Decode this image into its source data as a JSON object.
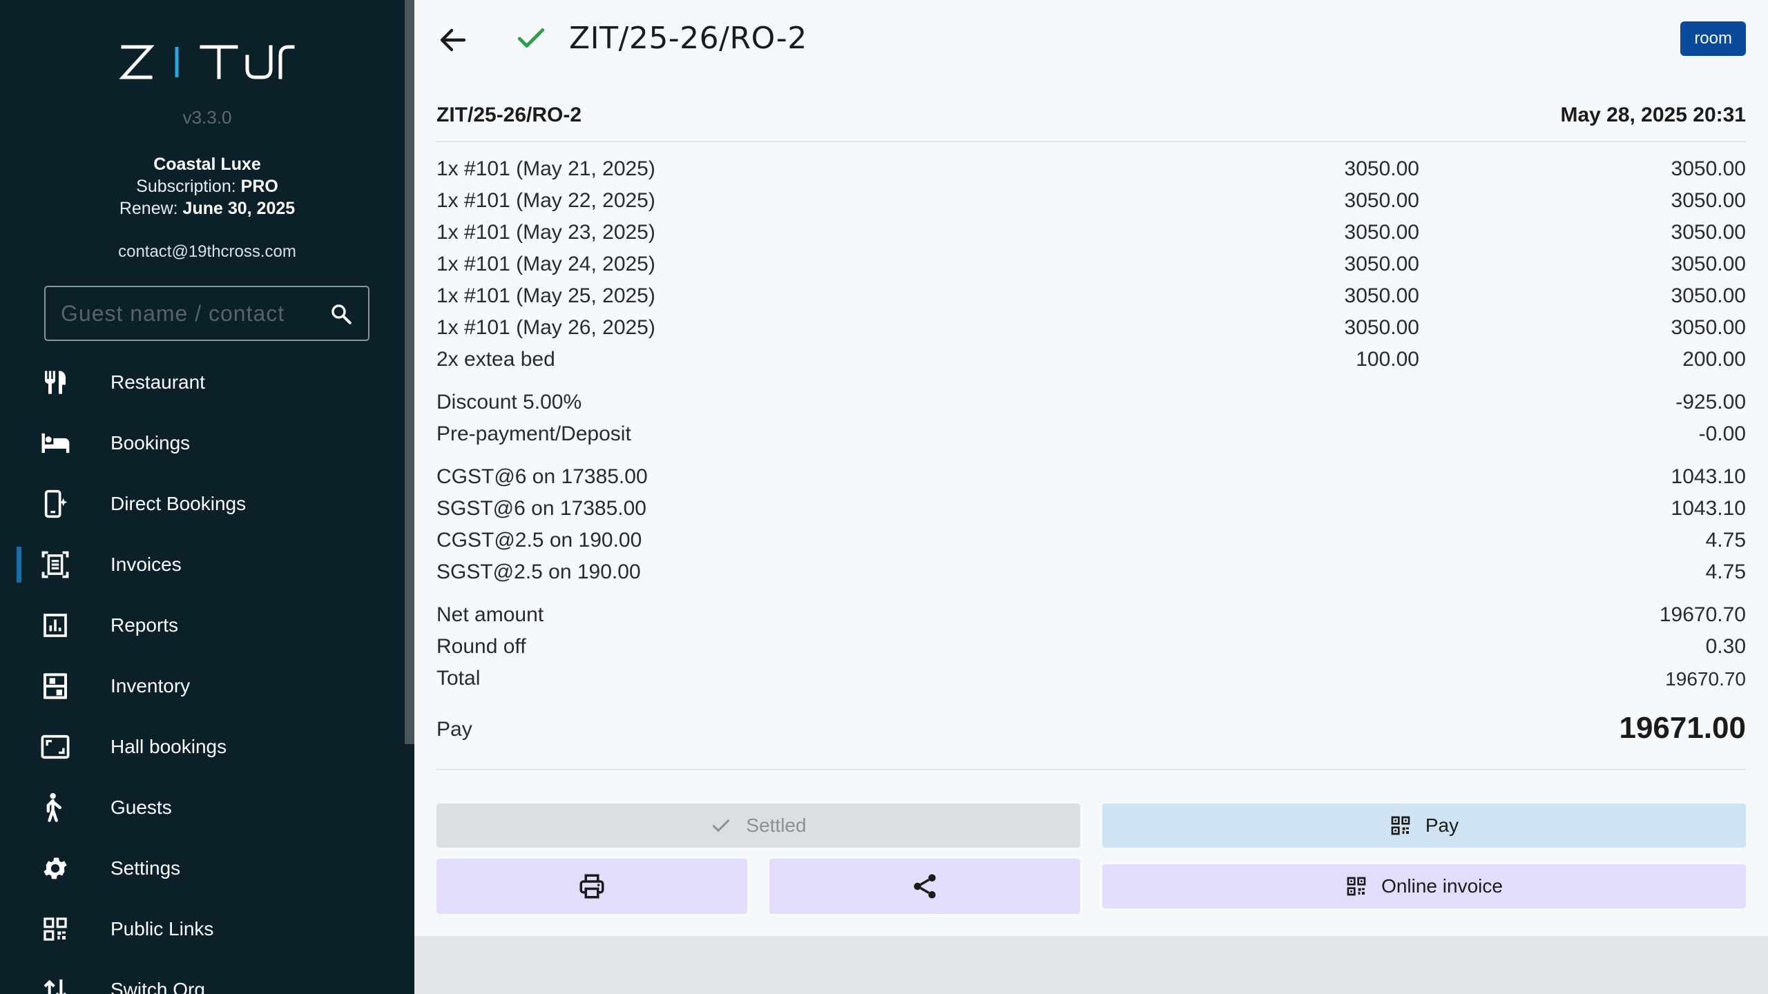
{
  "sidebar": {
    "logo": "ZITUN",
    "version": "v3.3.0",
    "org_name": "Coastal Luxe",
    "subscription_label": "Subscription:",
    "subscription_value": "PRO",
    "renew_label": "Renew:",
    "renew_value": "June 30, 2025",
    "contact": "contact@19thcross.com",
    "search_placeholder": "Guest name / contact",
    "items": [
      {
        "label": "Restaurant",
        "icon": "fork-knife-icon"
      },
      {
        "label": "Bookings",
        "icon": "bed-icon"
      },
      {
        "label": "Direct Bookings",
        "icon": "mobile-sparkle-icon"
      },
      {
        "label": "Invoices",
        "icon": "receipt-scan-icon",
        "active": true
      },
      {
        "label": "Reports",
        "icon": "bar-chart-icon"
      },
      {
        "label": "Inventory",
        "icon": "shelves-icon"
      },
      {
        "label": "Hall bookings",
        "icon": "aspect-ratio-icon"
      },
      {
        "label": "Guests",
        "icon": "person-walking-icon"
      },
      {
        "label": "Settings",
        "icon": "gear-icon"
      },
      {
        "label": "Public Links",
        "icon": "qr-code-icon"
      },
      {
        "label": "Switch Org",
        "icon": "swap-vert-icon"
      }
    ]
  },
  "header": {
    "title": "ZIT/25-26/RO-2",
    "room_button": "room"
  },
  "invoice": {
    "number": "ZIT/25-26/RO-2",
    "datetime": "May 28, 2025 20:31",
    "lines": [
      {
        "desc": "1x #101 (May 21, 2025)",
        "rate": "3050.00",
        "amount": "3050.00"
      },
      {
        "desc": "1x #101 (May 22, 2025)",
        "rate": "3050.00",
        "amount": "3050.00"
      },
      {
        "desc": "1x #101 (May 23, 2025)",
        "rate": "3050.00",
        "amount": "3050.00"
      },
      {
        "desc": "1x #101 (May 24, 2025)",
        "rate": "3050.00",
        "amount": "3050.00"
      },
      {
        "desc": "1x #101 (May 25, 2025)",
        "rate": "3050.00",
        "amount": "3050.00"
      },
      {
        "desc": "1x #101 (May 26, 2025)",
        "rate": "3050.00",
        "amount": "3050.00"
      },
      {
        "desc": "2x extea bed",
        "rate": "100.00",
        "amount": "200.00"
      }
    ],
    "adjustments": [
      {
        "desc": "Discount 5.00%",
        "amount": "-925.00"
      },
      {
        "desc": "Pre-payment/Deposit",
        "amount": "-0.00"
      }
    ],
    "taxes": [
      {
        "desc": "CGST@6 on 17385.00",
        "amount": "1043.10"
      },
      {
        "desc": "SGST@6 on 17385.00",
        "amount": "1043.10"
      },
      {
        "desc": "CGST@2.5 on 190.00",
        "amount": "4.75"
      },
      {
        "desc": "SGST@2.5 on 190.00",
        "amount": "4.75"
      }
    ],
    "totals": [
      {
        "desc": "Net amount",
        "amount": "19670.70"
      },
      {
        "desc": "Round off",
        "amount": "0.30"
      },
      {
        "desc": "Total",
        "amount": "19670.70"
      }
    ],
    "pay_label": "Pay",
    "pay_amount": "19671.00"
  },
  "actions": {
    "settled": "Settled",
    "pay": "Pay",
    "online_invoice": "Online invoice"
  },
  "colors": {
    "sidebar_bg": "#0b2029",
    "accent": "#1a6fa0",
    "room_button": "#0a4a9c",
    "success": "#2e9e4f"
  }
}
